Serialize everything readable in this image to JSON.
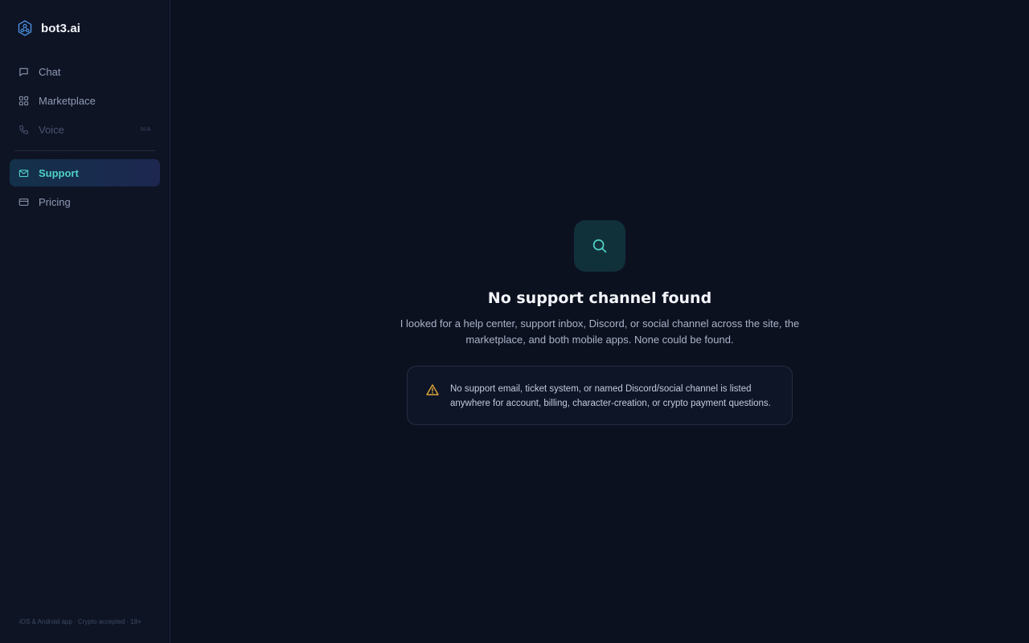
{
  "brand": {
    "name": "bot3.ai",
    "icon": "hexagon-network-icon"
  },
  "sidebar": {
    "items": [
      {
        "label": "Chat",
        "icon": "chat-bubble-icon",
        "active": false,
        "disabled": false
      },
      {
        "label": "Marketplace",
        "icon": "grid-icon",
        "active": false,
        "disabled": false
      },
      {
        "label": "Voice",
        "icon": "phone-icon",
        "active": false,
        "disabled": true,
        "badge": "N/A"
      },
      {
        "label": "Support",
        "icon": "mail-icon",
        "active": true,
        "disabled": false
      },
      {
        "label": "Pricing",
        "icon": "credit-card-icon",
        "active": false,
        "disabled": false
      }
    ],
    "footer": "iOS & Android app · Crypto accepted · 18+"
  },
  "main": {
    "icon": "search-icon",
    "title": "No support channel found",
    "description": "I looked for a help center, support inbox, Discord, or social channel across the site, the marketplace, and both mobile apps. None could be found.",
    "notice": {
      "icon": "warning-icon",
      "text": "No support email, ticket system, or named Discord/social channel is listed anywhere for account, billing, character-creation, or crypto payment questions."
    }
  },
  "colors": {
    "background": "#0c1120",
    "sidebar": "#0e1424",
    "accent": "#4fd1c5",
    "warning": "#e0a83a"
  }
}
